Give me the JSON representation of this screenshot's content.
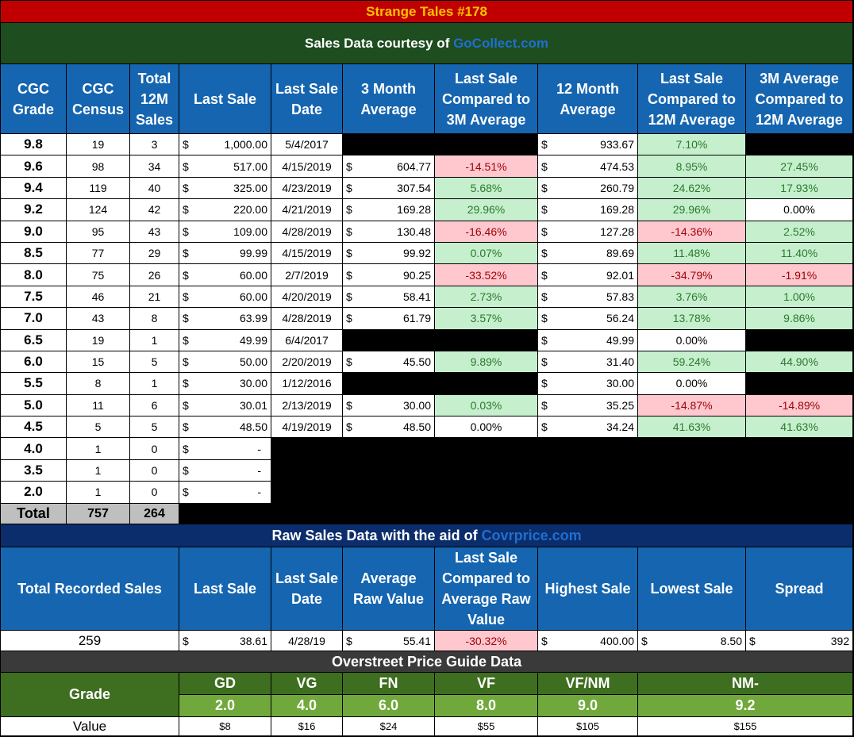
{
  "title": "Strange Tales #178",
  "subtitle": {
    "prefix": "Sales Data courtesy of ",
    "link": "GoCollect.com"
  },
  "headers": {
    "grade": "CGC Grade",
    "census": "CGC Census",
    "total12m": "Total 12M Sales",
    "last_sale": "Last Sale",
    "last_sale_date": "Last Sale Date",
    "avg3m": "3 Month Average",
    "cmp3m": "Last Sale Compared to 3M Average",
    "avg12m": "12 Month Average",
    "cmp12m": "Last Sale Compared to 12M Average",
    "cmp3m12m": "3M Average Compared to 12M Average"
  },
  "rows": [
    {
      "grade": "9.8",
      "census": "19",
      "sales": "3",
      "last": "1,000.00",
      "date": "5/4/2017",
      "avg3": "",
      "c3": "",
      "c3s": "blk",
      "avg12": "933.67",
      "c12": "7.10%",
      "c12s": "pos",
      "c312": "",
      "c312s": "blk"
    },
    {
      "grade": "9.6",
      "census": "98",
      "sales": "34",
      "last": "517.00",
      "date": "4/15/2019",
      "avg3": "604.77",
      "c3": "-14.51%",
      "c3s": "neg",
      "avg12": "474.53",
      "c12": "8.95%",
      "c12s": "pos",
      "c312": "27.45%",
      "c312s": "pos"
    },
    {
      "grade": "9.4",
      "census": "119",
      "sales": "40",
      "last": "325.00",
      "date": "4/23/2019",
      "avg3": "307.54",
      "c3": "5.68%",
      "c3s": "pos",
      "avg12": "260.79",
      "c12": "24.62%",
      "c12s": "pos",
      "c312": "17.93%",
      "c312s": "pos"
    },
    {
      "grade": "9.2",
      "census": "124",
      "sales": "42",
      "last": "220.00",
      "date": "4/21/2019",
      "avg3": "169.28",
      "c3": "29.96%",
      "c3s": "pos",
      "avg12": "169.28",
      "c12": "29.96%",
      "c12s": "pos",
      "c312": "0.00%",
      "c312s": "neu"
    },
    {
      "grade": "9.0",
      "census": "95",
      "sales": "43",
      "last": "109.00",
      "date": "4/28/2019",
      "avg3": "130.48",
      "c3": "-16.46%",
      "c3s": "neg",
      "avg12": "127.28",
      "c12": "-14.36%",
      "c12s": "neg",
      "c312": "2.52%",
      "c312s": "pos"
    },
    {
      "grade": "8.5",
      "census": "77",
      "sales": "29",
      "last": "99.99",
      "date": "4/15/2019",
      "avg3": "99.92",
      "c3": "0.07%",
      "c3s": "pos",
      "avg12": "89.69",
      "c12": "11.48%",
      "c12s": "pos",
      "c312": "11.40%",
      "c312s": "pos"
    },
    {
      "grade": "8.0",
      "census": "75",
      "sales": "26",
      "last": "60.00",
      "date": "2/7/2019",
      "avg3": "90.25",
      "c3": "-33.52%",
      "c3s": "neg",
      "avg12": "92.01",
      "c12": "-34.79%",
      "c12s": "neg",
      "c312": "-1.91%",
      "c312s": "neg"
    },
    {
      "grade": "7.5",
      "census": "46",
      "sales": "21",
      "last": "60.00",
      "date": "4/20/2019",
      "avg3": "58.41",
      "c3": "2.73%",
      "c3s": "pos",
      "avg12": "57.83",
      "c12": "3.76%",
      "c12s": "pos",
      "c312": "1.00%",
      "c312s": "pos"
    },
    {
      "grade": "7.0",
      "census": "43",
      "sales": "8",
      "last": "63.99",
      "date": "4/28/2019",
      "avg3": "61.79",
      "c3": "3.57%",
      "c3s": "pos",
      "avg12": "56.24",
      "c12": "13.78%",
      "c12s": "pos",
      "c312": "9.86%",
      "c312s": "pos"
    },
    {
      "grade": "6.5",
      "census": "19",
      "sales": "1",
      "last": "49.99",
      "date": "6/4/2017",
      "avg3": "",
      "c3": "",
      "c3s": "blk",
      "avg12": "49.99",
      "c12": "0.00%",
      "c12s": "neu",
      "c312": "",
      "c312s": "blk"
    },
    {
      "grade": "6.0",
      "census": "15",
      "sales": "5",
      "last": "50.00",
      "date": "2/20/2019",
      "avg3": "45.50",
      "c3": "9.89%",
      "c3s": "pos",
      "avg12": "31.40",
      "c12": "59.24%",
      "c12s": "pos",
      "c312": "44.90%",
      "c312s": "pos"
    },
    {
      "grade": "5.5",
      "census": "8",
      "sales": "1",
      "last": "30.00",
      "date": "1/12/2016",
      "avg3": "",
      "c3": "",
      "c3s": "blk",
      "avg12": "30.00",
      "c12": "0.00%",
      "c12s": "neu",
      "c312": "",
      "c312s": "blk"
    },
    {
      "grade": "5.0",
      "census": "11",
      "sales": "6",
      "last": "30.01",
      "date": "2/13/2019",
      "avg3": "30.00",
      "c3": "0.03%",
      "c3s": "pos",
      "avg12": "35.25",
      "c12": "-14.87%",
      "c12s": "neg",
      "c312": "-14.89%",
      "c312s": "neg"
    },
    {
      "grade": "4.5",
      "census": "5",
      "sales": "5",
      "last": "48.50",
      "date": "4/19/2019",
      "avg3": "48.50",
      "c3": "0.00%",
      "c3s": "neu",
      "avg12": "34.24",
      "c12": "41.63%",
      "c12s": "pos",
      "c312": "41.63%",
      "c312s": "pos"
    },
    {
      "grade": "4.0",
      "census": "1",
      "sales": "0",
      "last": "-",
      "date": "",
      "avg3": "",
      "c3": "",
      "c3s": "blk",
      "avg12": "",
      "c12": "",
      "c12s": "blk",
      "c312": "",
      "c312s": "blk",
      "short": true
    },
    {
      "grade": "3.5",
      "census": "1",
      "sales": "0",
      "last": "-",
      "date": "",
      "avg3": "",
      "c3": "",
      "c3s": "blk",
      "avg12": "",
      "c12": "",
      "c12s": "blk",
      "c312": "",
      "c312s": "blk",
      "short": true
    },
    {
      "grade": "2.0",
      "census": "1",
      "sales": "0",
      "last": "-",
      "date": "",
      "avg3": "",
      "c3": "",
      "c3s": "blk",
      "avg12": "",
      "c12": "",
      "c12s": "blk",
      "c312": "",
      "c312s": "blk",
      "short": true
    }
  ],
  "totals": {
    "label": "Total",
    "census": "757",
    "sales": "264"
  },
  "raw": {
    "title_prefix": "Raw Sales Data with the aid of ",
    "title_link": "Covrprice.com",
    "headers": {
      "total": "Total Recorded Sales",
      "last_sale": "Last Sale",
      "last_date": "Last Sale Date",
      "avg": "Average Raw Value",
      "cmp": "Last Sale Compared to Average Raw Value",
      "high": "Highest Sale",
      "low": "Lowest Sale",
      "spread": "Spread"
    },
    "values": {
      "total": "259",
      "last": "38.61",
      "date": "4/28/19",
      "avg": "55.41",
      "cmp": "-30.32%",
      "high": "400.00",
      "low": "8.50",
      "spread": "392"
    }
  },
  "overstreet": {
    "title": "Overstreet Price Guide Data",
    "grade_label": "Grade",
    "value_label": "Value",
    "names": [
      "GD",
      "VG",
      "FN",
      "VF",
      "VF/NM",
      "NM-"
    ],
    "numbers": [
      "2.0",
      "4.0",
      "6.0",
      "8.0",
      "9.0",
      "9.2"
    ],
    "values": [
      "$8",
      "$16",
      "$24",
      "$55",
      "$105",
      "$155"
    ]
  },
  "currency_symbol": "$",
  "colors": {
    "title_bg": "#c00000",
    "title_fg": "#ffc000",
    "header_bg": "#1565b0",
    "positive_bg": "#c6efce",
    "negative_bg": "#ffc7ce",
    "os_dark": "#3e6e1f",
    "os_light": "#70a83b"
  }
}
